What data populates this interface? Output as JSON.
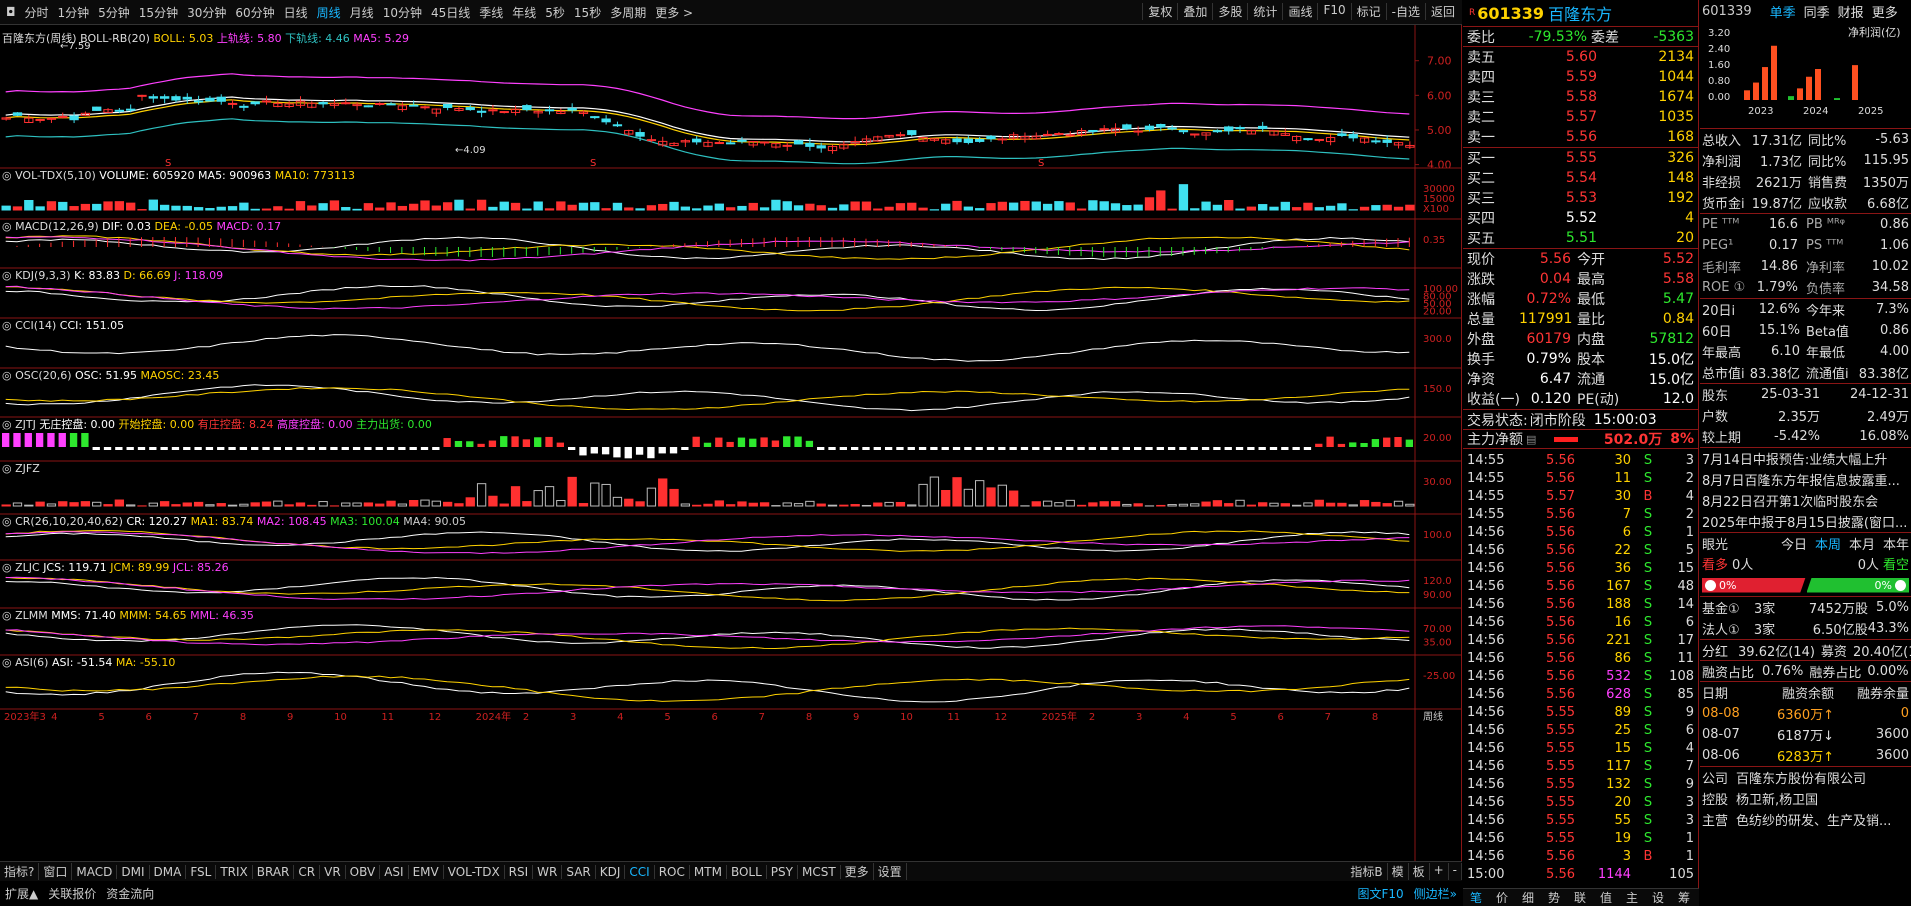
{
  "toolbar": {
    "left_icon": "◘",
    "periods": [
      "分时",
      "1分钟",
      "5分钟",
      "15分钟",
      "30分钟",
      "60分钟",
      "日线",
      "周线",
      "月线",
      "10分钟",
      "45日线",
      "季线",
      "年线",
      "5秒",
      "15秒",
      "多周期",
      "更多 >"
    ],
    "active_period": "周线",
    "right": [
      "复权",
      "叠加",
      "多股",
      "统计",
      "画线",
      "F10",
      "标记",
      "-自选",
      "返回"
    ]
  },
  "main_chart": {
    "title_prefix": "百隆东方(周线)",
    "indicator": "BOLL-RB(20)",
    "boll": "BOLL: 5.03",
    "upper": "上轨线: 5.80",
    "lower": "下轨线: 4.46",
    "ma5": "MA5: 5.29",
    "high_label": "7.59",
    "low_label": "4.09",
    "yticks": [
      "7.00",
      "6.00",
      "5.00",
      "4.00"
    ],
    "s_marks": [
      "S",
      "S",
      "S"
    ]
  },
  "panels": [
    {
      "name": "VOL-TDX(5,10)",
      "items": [
        {
          "t": "VOLUME: 605920",
          "c": "#ffffff"
        },
        {
          "t": "MA5: 900963",
          "c": "#ffffff"
        },
        {
          "t": "MA10: 773113",
          "c": "#ffd200"
        }
      ],
      "yticks": [
        "30000",
        "15000",
        "X100"
      ]
    },
    {
      "name": "MACD(12,26,9)",
      "items": [
        {
          "t": "DIF: 0.03",
          "c": "#ffffff"
        },
        {
          "t": "DEA: -0.05",
          "c": "#ffd200"
        },
        {
          "t": "MACD: 0.17",
          "c": "#ff40ff"
        }
      ],
      "yticks": [
        "0.35"
      ]
    },
    {
      "name": "KDJ(9,3,3)",
      "items": [
        {
          "t": "K: 83.83",
          "c": "#ffffff"
        },
        {
          "t": "D: 66.69",
          "c": "#ffd200"
        },
        {
          "t": "J: 118.09",
          "c": "#ff40ff"
        }
      ],
      "yticks": [
        "100.00",
        "80.00",
        "50.00",
        "20.00"
      ]
    },
    {
      "name": "CCI(14)",
      "items": [
        {
          "t": "CCI: 151.05",
          "c": "#ffffff"
        }
      ],
      "yticks": [
        "300.0"
      ]
    },
    {
      "name": "OSC(20,6)",
      "items": [
        {
          "t": "OSC: 51.95",
          "c": "#ffffff"
        },
        {
          "t": "MAOSC: 23.45",
          "c": "#ffd200"
        }
      ],
      "yticks": [
        "150.0"
      ]
    },
    {
      "name": "ZJTJ",
      "items": [
        {
          "t": "无庄控盘: 0.00",
          "c": "#ffffff"
        },
        {
          "t": "开始控盘: 0.00",
          "c": "#ffd200"
        },
        {
          "t": "有庄控盘: 8.24",
          "c": "#ff3535"
        },
        {
          "t": "高度控盘: 0.00",
          "c": "#ff40ff"
        },
        {
          "t": "主力出货: 0.00",
          "c": "#2ee82e"
        }
      ],
      "yticks": [
        "20.00"
      ]
    },
    {
      "name": "ZJFZ",
      "items": [],
      "yticks": [
        "30.00"
      ]
    },
    {
      "name": "CR(26,10,20,40,62)",
      "items": [
        {
          "t": "CR: 120.27",
          "c": "#ffffff"
        },
        {
          "t": "MA1: 83.74",
          "c": "#ffd200"
        },
        {
          "t": "MA2: 108.45",
          "c": "#ff40ff"
        },
        {
          "t": "MA3: 100.04",
          "c": "#2ee82e"
        },
        {
          "t": "MA4: 90.05",
          "c": "#cccccc"
        }
      ],
      "yticks": [
        "100.0"
      ]
    },
    {
      "name": "ZLJC",
      "items": [
        {
          "t": "JCS: 119.71",
          "c": "#ffffff"
        },
        {
          "t": "JCM: 89.99",
          "c": "#ffd200"
        },
        {
          "t": "JCL: 85.26",
          "c": "#ff40ff"
        }
      ],
      "yticks": [
        "120.0",
        "90.00"
      ]
    },
    {
      "name": "ZLMM",
      "items": [
        {
          "t": "MMS: 71.40",
          "c": "#ffffff"
        },
        {
          "t": "MMM: 54.65",
          "c": "#ffd200"
        },
        {
          "t": "MML: 46.35",
          "c": "#ff40ff"
        }
      ],
      "yticks": [
        "70.00",
        "35.00"
      ]
    },
    {
      "name": "ASI(6)",
      "items": [
        {
          "t": "ASI: -51.54",
          "c": "#ffffff"
        },
        {
          "t": "MA: -55.10",
          "c": "#ffd200"
        }
      ],
      "yticks": [
        "-25.00"
      ]
    }
  ],
  "xaxis": {
    "labels": [
      "2023年3",
      "4",
      "5",
      "6",
      "7",
      "8",
      "9",
      "10",
      "11",
      "12",
      "2024年",
      "2",
      "3",
      "4",
      "5",
      "6",
      "7",
      "8",
      "9",
      "10",
      "11",
      "12",
      "2025年",
      "2",
      "3",
      "4",
      "5",
      "6",
      "7",
      "8"
    ],
    "right_label": "周线"
  },
  "bottom_tabs": [
    "指标?",
    "窗口",
    "MACD",
    "DMI",
    "DMA",
    "FSL",
    "TRIX",
    "BRAR",
    "CR",
    "VR",
    "OBV",
    "ASI",
    "EMV",
    "VOL-TDX",
    "RSI",
    "WR",
    "SAR",
    "KDJ",
    "CCI",
    "ROC",
    "MTM",
    "BOLL",
    "PSY",
    "MCST",
    "更多",
    "设置"
  ],
  "bottom_right": [
    "指标B",
    "模",
    "板",
    "+",
    "-"
  ],
  "bottom_tabs2": [
    "扩展▲",
    "关联报价",
    "资金流向"
  ],
  "bottom_right2": [
    "图文F10",
    "侧边栏»"
  ],
  "quote": {
    "code": "601339",
    "name": "百隆东方",
    "r_badge": "R",
    "webi_label": "委比",
    "webi": "-79.53%",
    "weicha_label": "委差",
    "weicha": "-5363",
    "sells": [
      {
        "l": "卖五",
        "p": "5.60",
        "v": "2134"
      },
      {
        "l": "卖四",
        "p": "5.59",
        "v": "1044"
      },
      {
        "l": "卖三",
        "p": "5.58",
        "v": "1674"
      },
      {
        "l": "卖二",
        "p": "5.57",
        "v": "1035"
      },
      {
        "l": "卖一",
        "p": "5.56",
        "v": "168"
      }
    ],
    "buys": [
      {
        "l": "买一",
        "p": "5.55",
        "v": "326"
      },
      {
        "l": "买二",
        "p": "5.54",
        "v": "148"
      },
      {
        "l": "买三",
        "p": "5.53",
        "v": "192"
      },
      {
        "l": "买四",
        "p": "5.52",
        "v": "4"
      },
      {
        "l": "买五",
        "p": "5.51",
        "v": "20"
      }
    ],
    "stats": [
      [
        "现价",
        "5.56",
        "今开",
        "5.52"
      ],
      [
        "涨跌",
        "0.04",
        "最高",
        "5.58"
      ],
      [
        "涨幅",
        "0.72%",
        "最低",
        "5.47"
      ],
      [
        "总量",
        "117991",
        "量比",
        "0.84"
      ],
      [
        "外盘",
        "60179",
        "内盘",
        "57812"
      ],
      [
        "换手",
        "0.79%",
        "股本",
        "15.0亿"
      ],
      [
        "净资",
        "6.47",
        "流通",
        "15.0亿"
      ],
      [
        "收益(一)",
        "0.120",
        "PE(动)",
        "12.0"
      ]
    ],
    "status_label": "交易状态:",
    "status": "闭市阶段",
    "status_time": "15:00:03",
    "net_label": "主力净额",
    "net_value": "502.0万",
    "net_pct": "8%"
  },
  "ticks": [
    [
      "14:55",
      "5.56",
      "30",
      "S",
      "3"
    ],
    [
      "14:55",
      "5.56",
      "11",
      "S",
      "2"
    ],
    [
      "14:55",
      "5.57",
      "30",
      "B",
      "4"
    ],
    [
      "14:55",
      "5.56",
      "7",
      "S",
      "2"
    ],
    [
      "14:56",
      "5.56",
      "6",
      "S",
      "1"
    ],
    [
      "14:56",
      "5.56",
      "22",
      "S",
      "5"
    ],
    [
      "14:56",
      "5.56",
      "36",
      "S",
      "15"
    ],
    [
      "14:56",
      "5.56",
      "167",
      "S",
      "48"
    ],
    [
      "14:56",
      "5.56",
      "188",
      "S",
      "14"
    ],
    [
      "14:56",
      "5.56",
      "16",
      "S",
      "6"
    ],
    [
      "14:56",
      "5.56",
      "221",
      "S",
      "17"
    ],
    [
      "14:56",
      "5.56",
      "86",
      "S",
      "11"
    ],
    [
      "14:56",
      "5.56",
      "532",
      "S",
      "108"
    ],
    [
      "14:56",
      "5.56",
      "628",
      "S",
      "85"
    ],
    [
      "14:56",
      "5.55",
      "89",
      "S",
      "9"
    ],
    [
      "14:56",
      "5.55",
      "25",
      "S",
      "6"
    ],
    [
      "14:56",
      "5.55",
      "15",
      "S",
      "4"
    ],
    [
      "14:56",
      "5.55",
      "117",
      "S",
      "7"
    ],
    [
      "14:56",
      "5.55",
      "132",
      "S",
      "9"
    ],
    [
      "14:56",
      "5.55",
      "20",
      "S",
      "3"
    ],
    [
      "14:56",
      "5.55",
      "55",
      "S",
      "3"
    ],
    [
      "14:56",
      "5.55",
      "19",
      "S",
      "1"
    ],
    [
      "14:56",
      "5.56",
      "3",
      "B",
      "1"
    ],
    [
      "15:00",
      "5.56",
      "1144",
      "",
      "105"
    ]
  ],
  "mid_bottom_tabs": [
    "笔",
    "价",
    "细",
    "势",
    "联",
    "值",
    "主",
    "设",
    "筹"
  ],
  "right": {
    "code": "601339",
    "tabs": [
      "单季",
      "同季",
      "财报",
      "更多"
    ],
    "chart_unit": "净利润(亿)",
    "chart_y": [
      "3.20",
      "2.40",
      "1.60",
      "0.80",
      "0.00"
    ],
    "chart_x": [
      "2023",
      "2024",
      "2025"
    ],
    "fin": [
      [
        "总收入",
        "17.31亿",
        "同比%",
        "-5.63"
      ],
      [
        "净利润",
        "1.73亿",
        "同比%",
        "115.95"
      ],
      [
        "非经损",
        "2621万",
        "销售费",
        "1350万"
      ],
      [
        "货币金i",
        "19.87亿",
        "应收款",
        "6.68亿"
      ]
    ],
    "val": [
      [
        "PE ᵀᵀᴹ",
        "16.6",
        "PB ᴹᴿᵠ",
        "0.86"
      ],
      [
        "PEG¹",
        "0.17",
        "PS ᵀᵀᴹ",
        "1.06"
      ],
      [
        "毛利率",
        "14.86",
        "净利率",
        "10.02"
      ],
      [
        "ROE ①",
        "1.79%",
        "负债率",
        "34.58"
      ]
    ],
    "perf": [
      [
        "20日i",
        "12.6%",
        "今年来",
        "7.3%"
      ],
      [
        "60日",
        "15.1%",
        "Beta值",
        "0.86"
      ],
      [
        "年最高",
        "6.10",
        "年最低",
        "4.00"
      ],
      [
        "总市值i",
        "83.38亿",
        "流通值i",
        "83.38亿"
      ]
    ],
    "holders": [
      [
        "股东",
        "25-03-31",
        "24-12-31"
      ],
      [
        "户数",
        "2.35万",
        "2.49万"
      ],
      [
        "较上期",
        "-5.42%",
        "16.08%"
      ]
    ],
    "news": [
      "7月14日中报预告:业绩大幅上升",
      "8月7日百隆东方年报信息披露重...",
      "8月22日召开第1次临时股东会",
      "2025年中报于8月15日披露(窗口..."
    ],
    "eye_label": "眼光",
    "eye_tabs": [
      "今日",
      "本周",
      "本月",
      "本年"
    ],
    "bull": "看多",
    "bull_n": "0人",
    "bear_n": "0人",
    "bear": "看空",
    "bull_pct": "0%",
    "bear_pct": "0%",
    "inst": [
      [
        "基金①",
        "3家",
        "7452万股",
        "5.0%"
      ],
      [
        "法人①",
        "3家",
        "6.50亿股",
        "43.3%"
      ]
    ],
    "div": [
      "分红",
      "39.62亿(14)",
      "募资",
      "20.40亿(1"
    ],
    "margin": [
      "融资占比",
      "0.76%",
      "融券占比",
      "0.00%"
    ],
    "margin_head": [
      "日期",
      "融资余额",
      "融券余量"
    ],
    "margin_rows": [
      [
        "08-08",
        "6360万↑",
        "0"
      ],
      [
        "08-07",
        "6187万↓",
        "3600"
      ],
      [
        "08-06",
        "6283万↑",
        "3600"
      ]
    ],
    "company": [
      [
        "公司",
        "百隆东方股份有限公司"
      ],
      [
        "控股",
        "杨卫新,杨卫国"
      ],
      [
        "主营",
        "色纺纱的研发、生产及销..."
      ]
    ]
  }
}
